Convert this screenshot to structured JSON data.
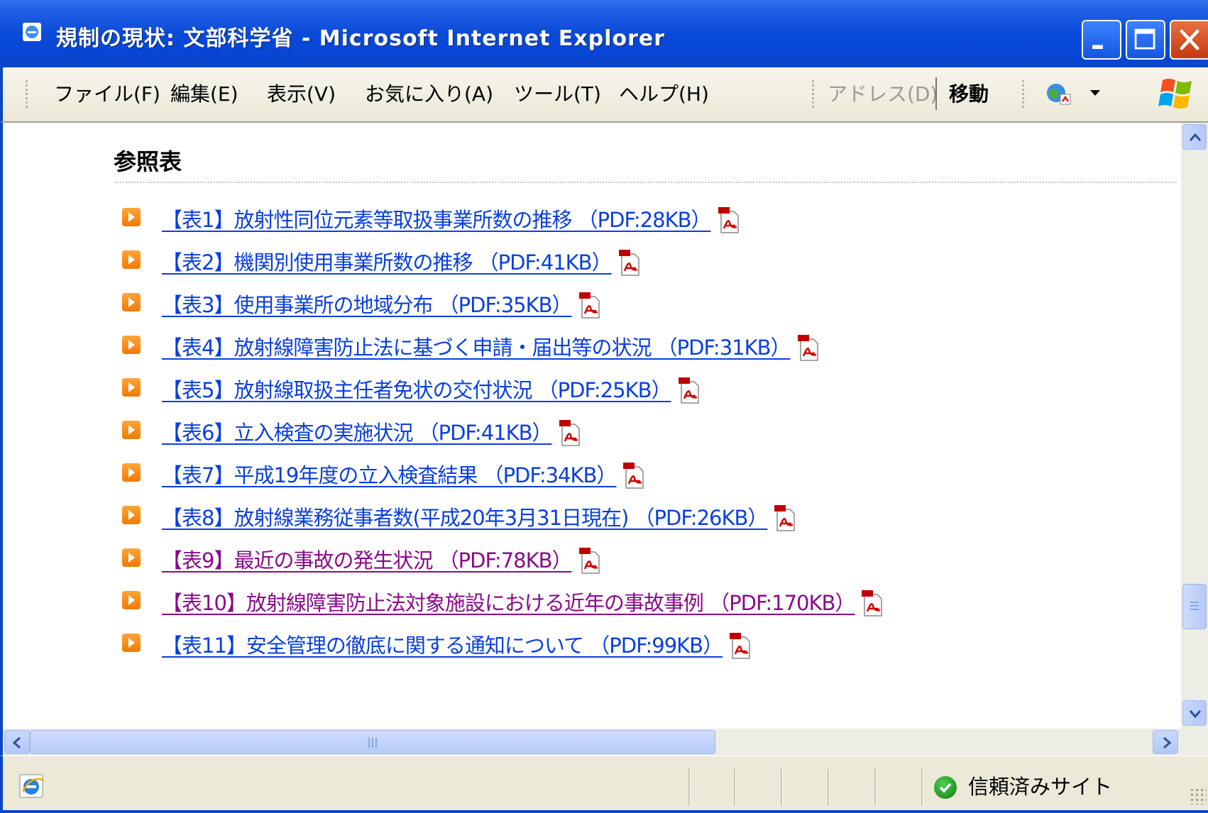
{
  "window": {
    "title": "規制の現状: 文部科学省 - Microsoft Internet Explorer"
  },
  "menu": {
    "items": [
      "ファイル(F)",
      "編集(E)",
      "表示(V)",
      "お気に入り(A)",
      "ツール(T)",
      "ヘルプ(H)"
    ],
    "address_label": "アドレス(D)",
    "go_label": "移動"
  },
  "content": {
    "heading": "参照表",
    "links": [
      {
        "text": "【表1】放射性同位元素等取扱事業所数の推移 （PDF:28KB）",
        "visited": false
      },
      {
        "text": "【表2】機関別使用事業所数の推移 （PDF:41KB）",
        "visited": false
      },
      {
        "text": "【表3】使用事業所の地域分布 （PDF:35KB）",
        "visited": false
      },
      {
        "text": "【表4】放射線障害防止法に基づく申請・届出等の状況 （PDF:31KB）",
        "visited": false
      },
      {
        "text": "【表5】放射線取扱主任者免状の交付状況 （PDF:25KB）",
        "visited": false
      },
      {
        "text": "【表6】立入検査の実施状況 （PDF:41KB）",
        "visited": false
      },
      {
        "text": "【表7】平成19年度の立入検査結果 （PDF:34KB）",
        "visited": false
      },
      {
        "text": "【表8】放射線業務従事者数(平成20年3月31日現在) （PDF:26KB）",
        "visited": false
      },
      {
        "text": "【表9】最近の事故の発生状況 （PDF:78KB）",
        "visited": true
      },
      {
        "text": "【表10】放射線障害防止法対象施設における近年の事故事例 （PDF:170KB）",
        "visited": true
      },
      {
        "text": "【表11】安全管理の徹底に関する通知について （PDF:99KB）",
        "visited": false
      }
    ]
  },
  "status": {
    "zone_label": "信頼済みサイト"
  },
  "colors": {
    "link": "#0a3fe0",
    "visited_link": "#8a0a8a",
    "titlebar": "#0a4ad8",
    "bullet": "#f07a00"
  }
}
